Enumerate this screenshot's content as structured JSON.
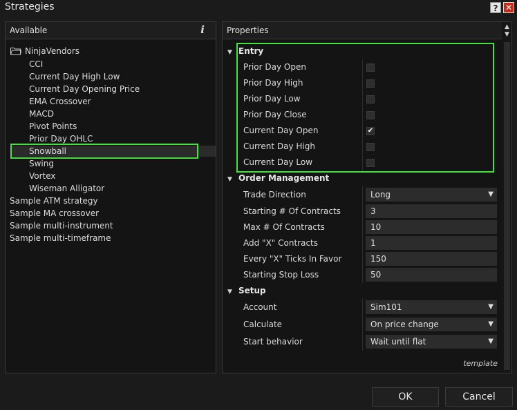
{
  "window": {
    "title": "Strategies",
    "help_label": "?",
    "close_label": "✕"
  },
  "available": {
    "header": "Available",
    "info_label": "i",
    "folder": "NinjaVendors",
    "items": [
      "CCI",
      "Current Day High Low",
      "Current Day Opening Price",
      "EMA Crossover",
      "MACD",
      "Pivot Points",
      "Prior Day OHLC",
      "Snowball",
      "Swing",
      "Vortex",
      "Wiseman Alligator"
    ],
    "root_items": [
      "Sample ATM strategy",
      "Sample MA crossover",
      "Sample multi-instrument",
      "Sample multi-timeframe"
    ],
    "selected": "Snowball"
  },
  "properties": {
    "header": "Properties",
    "entry": {
      "title": "Entry",
      "rows": [
        {
          "label": "Prior Day Open",
          "checked": false
        },
        {
          "label": "Prior Day High",
          "checked": false
        },
        {
          "label": "Prior Day Low",
          "checked": false
        },
        {
          "label": "Prior Day Close",
          "checked": false
        },
        {
          "label": "Current Day Open",
          "checked": true
        },
        {
          "label": "Current Day High",
          "checked": false
        },
        {
          "label": "Current Day Low",
          "checked": false
        }
      ]
    },
    "order_management": {
      "title": "Order Management",
      "rows": [
        {
          "label": "Trade Direction",
          "value": "Long",
          "dropdown": true
        },
        {
          "label": "Starting # Of Contracts",
          "value": "3"
        },
        {
          "label": "Max # Of Contracts",
          "value": "10"
        },
        {
          "label": "Add \"X\" Contracts",
          "value": "1"
        },
        {
          "label": "Every \"X\" Ticks In Favor",
          "value": "150"
        },
        {
          "label": "Starting Stop Loss",
          "value": "50"
        }
      ]
    },
    "setup": {
      "title": "Setup",
      "rows": [
        {
          "label": "Account",
          "value": "Sim101",
          "dropdown": true
        },
        {
          "label": "Calculate",
          "value": "On price change",
          "dropdown": true
        },
        {
          "label": "Start behavior",
          "value": "Wait until flat",
          "dropdown": true
        }
      ]
    },
    "template_link": "template"
  },
  "footer": {
    "ok_label": "OK",
    "cancel_label": "Cancel"
  },
  "colors": {
    "background": "#1b1b1b",
    "panel": "#141414",
    "highlight": "#46e23e",
    "close": "#c42b1c"
  }
}
